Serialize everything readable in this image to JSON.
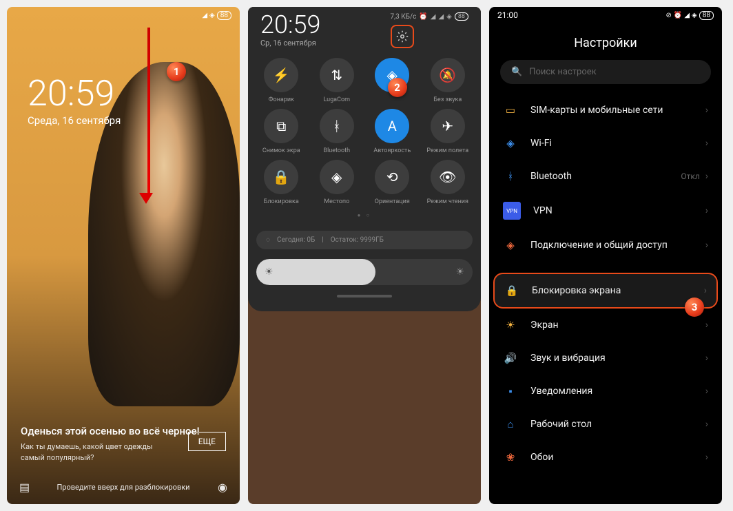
{
  "lockscreen": {
    "time": "20:59",
    "date": "Среда, 16 сентября",
    "headline": "Оденься этой осенью во всё черное!",
    "subtext": "Как ты думаешь, какой цвет одежды самый популярный?",
    "more_btn": "ЕЩЕ",
    "unlock_hint": "Проведите вверх для разблокировки",
    "battery": "88"
  },
  "qs": {
    "time": "20:59",
    "date": "Ср, 16 сентября",
    "net_speed": "7,3 КБ/с",
    "battery": "88",
    "tiles": [
      {
        "label": "Фонарик",
        "icon": "flashlight",
        "on": false
      },
      {
        "label": "LugaCom",
        "icon": "data",
        "on": false
      },
      {
        "label": "",
        "icon": "wifi",
        "on": true
      },
      {
        "label": "Без звука",
        "icon": "mute",
        "on": false
      },
      {
        "label": "Снимок экра",
        "icon": "screenshot",
        "on": false
      },
      {
        "label": "Bluetooth",
        "icon": "bluetooth",
        "on": false
      },
      {
        "label": "Автояркость",
        "icon": "autobright",
        "on": true
      },
      {
        "label": "Режим полета",
        "icon": "airplane",
        "on": false
      },
      {
        "label": "Блокировка",
        "icon": "lock",
        "on": false
      },
      {
        "label": "Местопо",
        "icon": "location",
        "on": false
      },
      {
        "label": "Ориентация",
        "icon": "rotate",
        "on": false
      },
      {
        "label": "Режим чтения",
        "icon": "read",
        "on": false
      }
    ],
    "usage_today": "Сегодня: 0Б",
    "usage_remain": "Остаток: 9999ГБ"
  },
  "settings": {
    "statusbar_time": "21:00",
    "battery": "88",
    "title": "Настройки",
    "search_placeholder": "Поиск настроек",
    "items": [
      {
        "icon": "sim",
        "label": "SIM-карты и мобильные сети",
        "cls": "ic-sim"
      },
      {
        "icon": "wifi",
        "label": "Wi-Fi",
        "cls": "ic-wifi",
        "value": ""
      },
      {
        "icon": "bt",
        "label": "Bluetooth",
        "cls": "ic-bt",
        "value": "Откл"
      },
      {
        "icon": "vpn",
        "label": "VPN",
        "cls": "ic-vpn"
      },
      {
        "icon": "share",
        "label": "Подключение и общий доступ",
        "cls": "ic-share"
      },
      {
        "gap": true
      },
      {
        "icon": "lock",
        "label": "Блокировка экрана",
        "cls": "ic-lock",
        "hl": true
      },
      {
        "icon": "disp",
        "label": "Экран",
        "cls": "ic-disp"
      },
      {
        "icon": "snd",
        "label": "Звук и вибрация",
        "cls": "ic-snd"
      },
      {
        "icon": "notif",
        "label": "Уведомления",
        "cls": "ic-notif"
      },
      {
        "icon": "home",
        "label": "Рабочий стол",
        "cls": "ic-home"
      },
      {
        "icon": "wall",
        "label": "Обои",
        "cls": "ic-wall"
      }
    ]
  },
  "badges": {
    "b1": "1",
    "b2": "2",
    "b3": "3"
  }
}
